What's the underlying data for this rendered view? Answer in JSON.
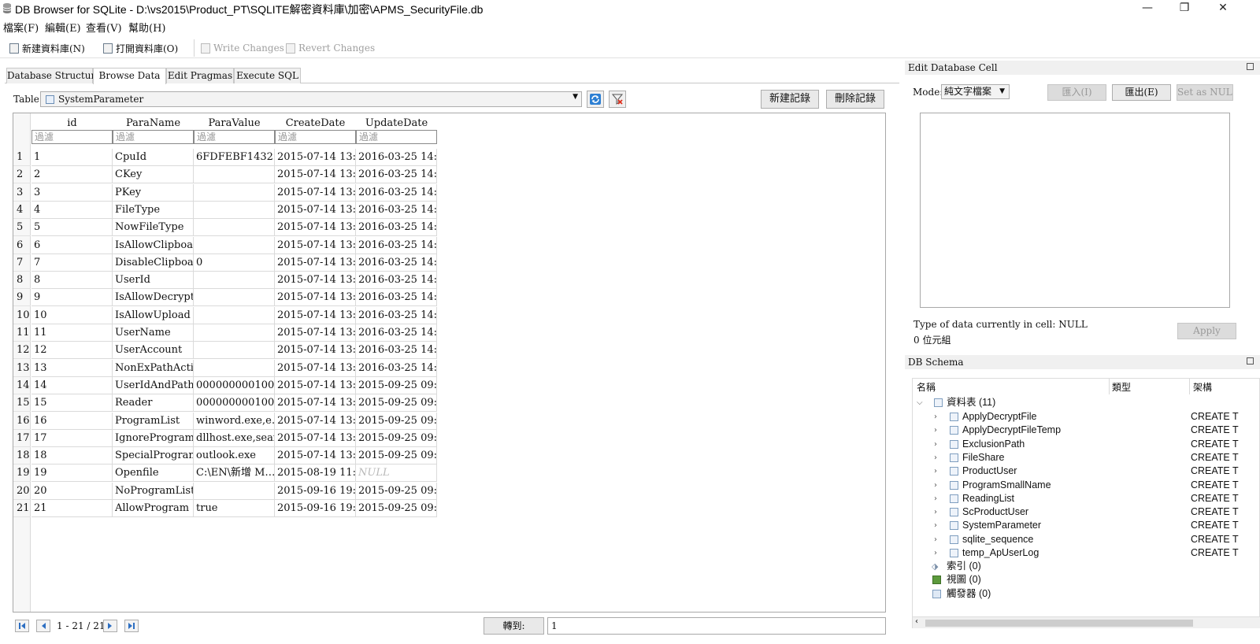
{
  "window": {
    "title": "DB Browser for SQLite - D:\\vs2015\\Product_PT\\SQLITE解密資料庫\\加密\\APMS_SecurityFile.db",
    "minimize": "—",
    "maximize": "❐",
    "close": "✕"
  },
  "menu": [
    "檔案(F)",
    "編輯(E)",
    "查看(V)",
    "幫助(H)"
  ],
  "toolbar": {
    "new_db": "新建資料庫(N)",
    "open_db": "打開資料庫(O)",
    "write_changes": "Write Changes",
    "revert_changes": "Revert Changes"
  },
  "tabs": [
    "Database Structure",
    "Browse Data",
    "Edit Pragmas",
    "Execute SQL"
  ],
  "browse": {
    "table_label": "Table:",
    "table_name": "SystemParameter",
    "new_record": "新建記錄",
    "delete_record": "刪除記錄",
    "columns": [
      "id",
      "ParaName",
      "ParaValue",
      "CreateDate",
      "UpdateDate"
    ],
    "filter_placeholder": "過濾",
    "rows": [
      [
        "1",
        "1",
        "CpuId",
        "6FDFEBF1432…",
        "2015-07-14 13:…",
        "2016-03-25 14:…"
      ],
      [
        "2",
        "2",
        "CKey",
        "",
        "2015-07-14 13:…",
        "2016-03-25 14:…"
      ],
      [
        "3",
        "3",
        "PKey",
        "",
        "2015-07-14 13:…",
        "2016-03-25 14:…"
      ],
      [
        "4",
        "4",
        "FileType",
        "",
        "2015-07-14 13:…",
        "2016-03-25 14:…"
      ],
      [
        "5",
        "5",
        "NowFileType",
        "",
        "2015-07-14 13:…",
        "2016-03-25 14:…"
      ],
      [
        "6",
        "6",
        "IsAllowClipboard",
        "",
        "2015-07-14 13:…",
        "2016-03-25 14:…"
      ],
      [
        "7",
        "7",
        "DisableClipboa…",
        "0",
        "2015-07-14 13:…",
        "2016-03-25 14:…"
      ],
      [
        "8",
        "8",
        "UserId",
        "",
        "2015-07-14 13:…",
        "2016-03-25 14:…"
      ],
      [
        "9",
        "9",
        "IsAllowDecrypt",
        "",
        "2015-07-14 13:…",
        "2016-03-25 14:…"
      ],
      [
        "10",
        "10",
        "IsAllowUpload",
        "",
        "2015-07-14 13:…",
        "2016-03-25 14:…"
      ],
      [
        "11",
        "11",
        "UserName",
        "",
        "2015-07-14 13:…",
        "2016-03-25 14:…"
      ],
      [
        "12",
        "12",
        "UserAccount",
        "",
        "2015-07-14 13:…",
        "2016-03-25 14:…"
      ],
      [
        "13",
        "13",
        "NonExPathAction",
        "",
        "2015-07-14 13:…",
        "2016-03-25 14:…"
      ],
      [
        "14",
        "14",
        "UserIdAndPath",
        "000000000100…",
        "2015-07-14 13:…",
        "2015-09-25 09:…"
      ],
      [
        "15",
        "15",
        "Reader",
        "000000000100…",
        "2015-07-14 13:…",
        "2015-09-25 09:…"
      ],
      [
        "16",
        "16",
        "ProgramList",
        "winword.exe,e…",
        "2015-07-14 13:…",
        "2015-09-25 09:…"
      ],
      [
        "17",
        "17",
        "IgnoreProgram…",
        "dllhost.exe,sear…",
        "2015-07-14 13:…",
        "2015-09-25 09:…"
      ],
      [
        "18",
        "18",
        "SpecialProgram…",
        "outlook.exe",
        "2015-07-14 13:…",
        "2015-09-25 09:…"
      ],
      [
        "19",
        "19",
        "Openfile",
        "C:\\EN\\新增 M…",
        "2015-08-19 11:…",
        "NULL"
      ],
      [
        "20",
        "20",
        "NoProgramList",
        "",
        "2015-09-16 19:…",
        "2015-09-25 09:…"
      ],
      [
        "21",
        "21",
        "AllowProgram",
        "true",
        "2015-09-16 19:…",
        "2015-09-25 09:…"
      ]
    ],
    "record_count": "1 - 21 / 21",
    "goto_label": "轉到:",
    "goto_value": "1"
  },
  "edit_cell": {
    "title": "Edit Database Cell",
    "mode_label": "Mode:",
    "mode_value": "純文字檔案",
    "import": "匯入(I)",
    "export": "匯出(E)",
    "set_null": "Set as NULL",
    "type_text": "Type of data currently in cell: NULL",
    "size_text": "0 位元組",
    "apply": "Apply"
  },
  "schema": {
    "title": "DB Schema",
    "headers": [
      "名稱",
      "類型",
      "架構"
    ],
    "tables_node": "資料表 (11)",
    "tables": [
      "ApplyDecryptFile",
      "ApplyDecryptFileTemp",
      "ExclusionPath",
      "FileShare",
      "ProductUser",
      "ProgramSmallName",
      "ReadingList",
      "ScProductUser",
      "SystemParameter",
      "sqlite_sequence",
      "temp_ApUserLog"
    ],
    "table_schema": "CREATE T",
    "indices_node": "索引 (0)",
    "views_node": "視圖 (0)",
    "triggers_node": "觸發器 (0)"
  }
}
